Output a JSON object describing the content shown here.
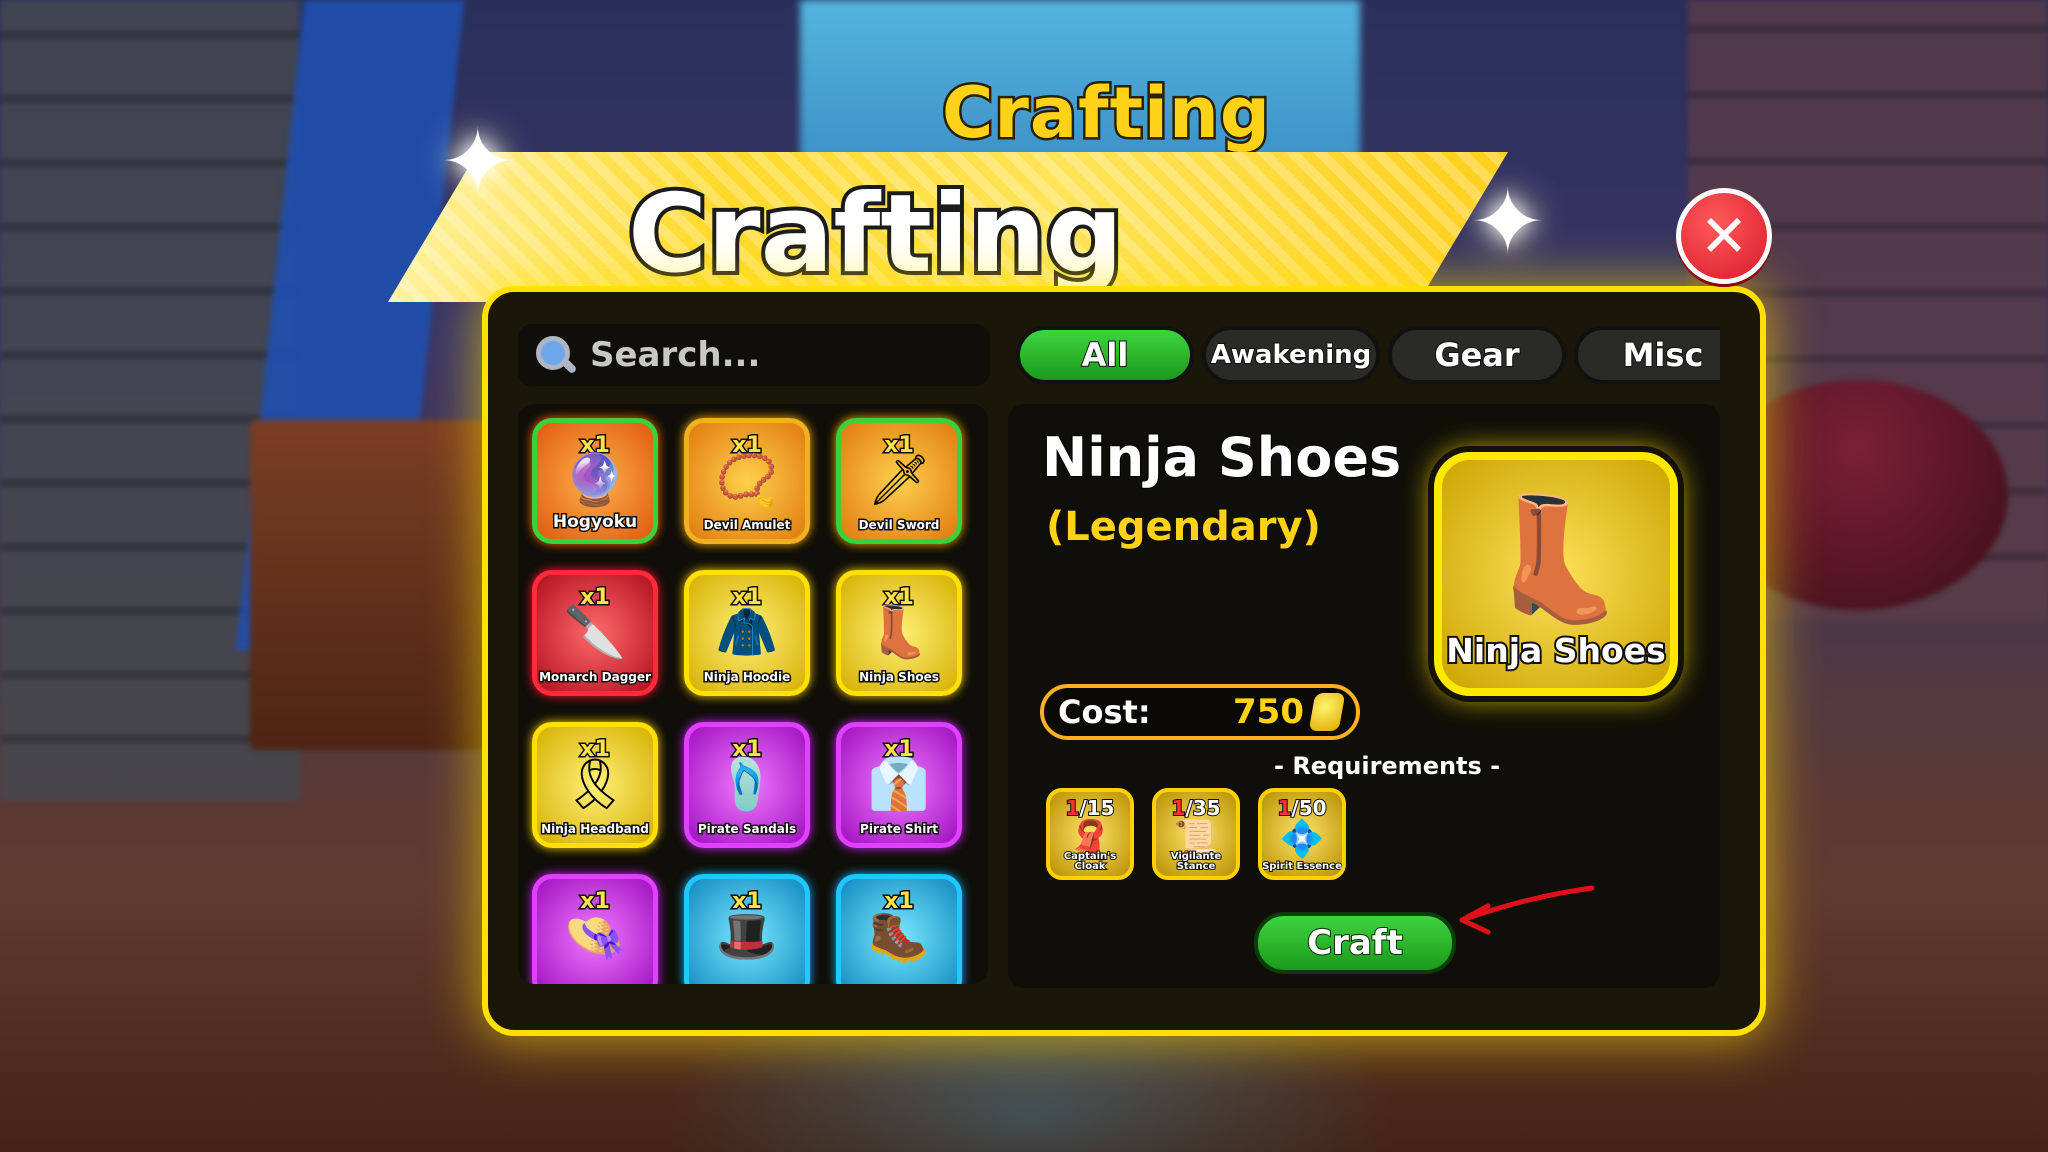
{
  "window": {
    "title_small": "Crafting",
    "title_big": "Crafting",
    "close_label": "✕"
  },
  "search": {
    "placeholder": "Search..."
  },
  "tabs": [
    {
      "label": "All",
      "active": true
    },
    {
      "label": "Awakening",
      "active": false
    },
    {
      "label": "Gear",
      "active": false
    },
    {
      "label": "Misc",
      "active": false
    }
  ],
  "items": [
    {
      "name": "Hogyoku",
      "qty": "x1",
      "icon": "orb-icon",
      "rarity_color": "#e05a10"
    },
    {
      "name": "Devil Amulet",
      "qty": "x1",
      "icon": "amulet-icon",
      "rarity_color": "#e07a10"
    },
    {
      "name": "Devil Sword",
      "qty": "x1",
      "icon": "sword-icon",
      "rarity_color": "#e07a10"
    },
    {
      "name": "Monarch Dagger",
      "qty": "x1",
      "icon": "dagger-icon",
      "rarity_color": "#b0101e"
    },
    {
      "name": "Ninja Hoodie",
      "qty": "x1",
      "icon": "hoodie-icon",
      "rarity_color": "#d6b000"
    },
    {
      "name": "Ninja Shoes",
      "qty": "x1",
      "icon": "boots-icon",
      "rarity_color": "#d6b000"
    },
    {
      "name": "Ninja Headband",
      "qty": "x1",
      "icon": "headband-icon",
      "rarity_color": "#d6b000"
    },
    {
      "name": "Pirate Sandals",
      "qty": "x1",
      "icon": "sandals-icon",
      "rarity_color": "#a010c0"
    },
    {
      "name": "Pirate Shirt",
      "qty": "x1",
      "icon": "shirt-icon",
      "rarity_color": "#a010c0"
    },
    {
      "name": "",
      "qty": "x1",
      "icon": "straw-hat-icon",
      "rarity_color": "#a010c0"
    },
    {
      "name": "",
      "qty": "x1",
      "icon": "hat-icon",
      "rarity_color": "#108ac0"
    },
    {
      "name": "",
      "qty": "x1",
      "icon": "boots-icon",
      "rarity_color": "#108ac0"
    }
  ],
  "detail": {
    "name": "Ninja Shoes",
    "rarity": "(Legendary)",
    "preview_label": "Ninja Shoes",
    "cost_label": "Cost:",
    "cost_value": "750",
    "requirements_title": "- Requirements -",
    "requirements": [
      {
        "have": "1",
        "need": "/15",
        "name": "Captain's Cloak",
        "icon": "cloak-icon"
      },
      {
        "have": "1",
        "need": "/35",
        "name": "Vigilante Stance",
        "icon": "stance-icon"
      },
      {
        "have": "1",
        "need": "/50",
        "name": "Spirit Essence",
        "icon": "essence-icon"
      }
    ],
    "craft_label": "Craft"
  }
}
